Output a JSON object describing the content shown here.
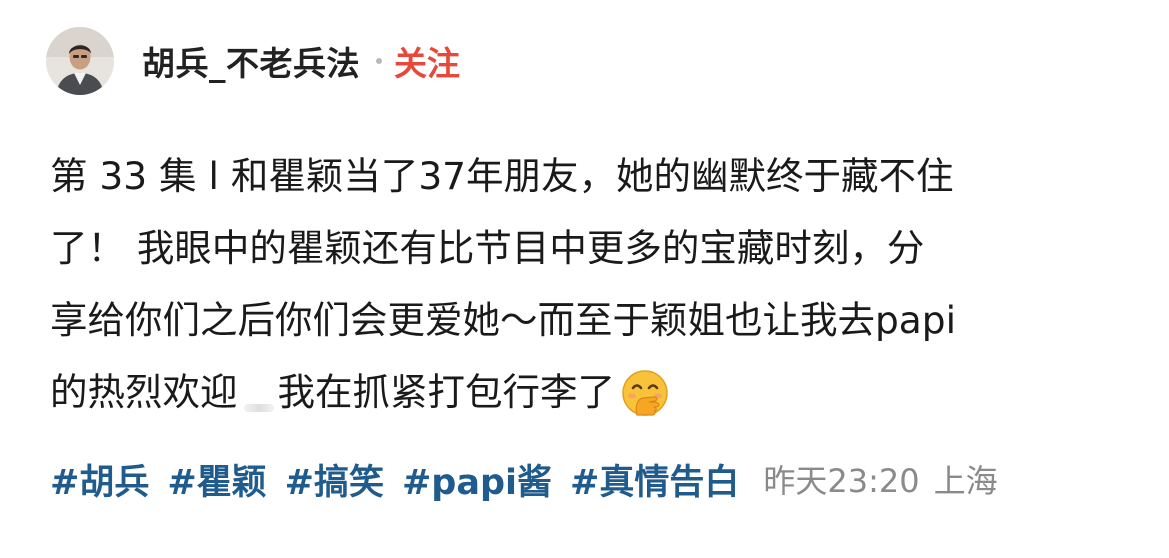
{
  "post": {
    "author": {
      "name": "胡兵_不老兵法",
      "separator": "·",
      "follow_label": "关注"
    },
    "body": {
      "line1": "第 33 集 l 和瞿颖当了37年朋友，她的幽默终于藏不住",
      "line2": "了！  我眼中的瞿颖还有比节目中更多的宝藏时刻，分",
      "line3": "享给你们之后你们会更爱她～而至于颖姐也让我去papi",
      "line4_a": "的热烈欢迎",
      "line4_b": "我在抓紧打包行李了",
      "emoji": "face-with-hand-over-mouth"
    },
    "hashtags": [
      "#胡兵",
      "#瞿颖",
      "#搞笑",
      "#papi酱",
      "#真情告白"
    ],
    "time": "昨天23:20",
    "location": "上海",
    "colors": {
      "follow": "#e8483a",
      "hashtag": "#1f5b8c",
      "meta": "#8a8a8a"
    }
  }
}
